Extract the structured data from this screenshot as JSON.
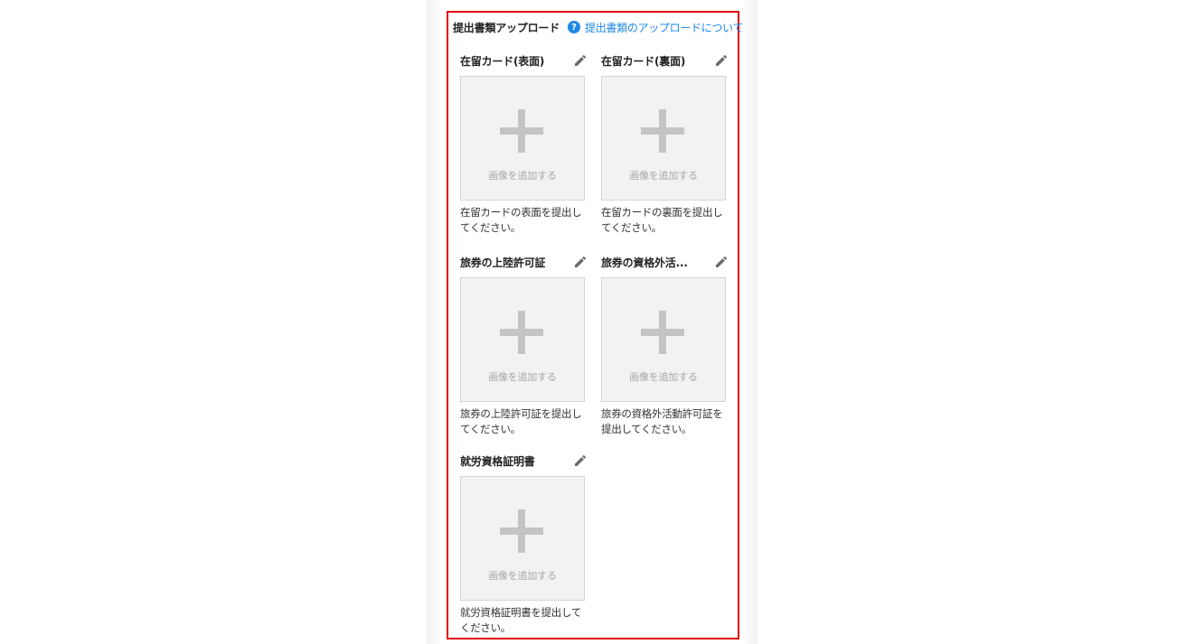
{
  "section": {
    "title": "提出書類アップロード",
    "help_icon": "question-circle-icon",
    "help_link": "提出書類のアップロードについて",
    "accent_color": "#1e88e5",
    "highlight_border_color": "#e00000"
  },
  "upload_label": "画像を追加する",
  "documents": [
    {
      "title": "在留カード(表面)",
      "description": "在留カードの表面を提出してください。"
    },
    {
      "title": "在留カード(裏面)",
      "description": "在留カードの裏面を提出してください。"
    },
    {
      "title": "旅券の上陸許可証",
      "description": "旅券の上陸許可証を提出してください。"
    },
    {
      "title": "旅券の資格外活...",
      "description": "旅券の資格外活動許可証を提出してください。"
    },
    {
      "title": "就労資格証明書",
      "description": "就労資格証明書を提出してください。"
    }
  ]
}
